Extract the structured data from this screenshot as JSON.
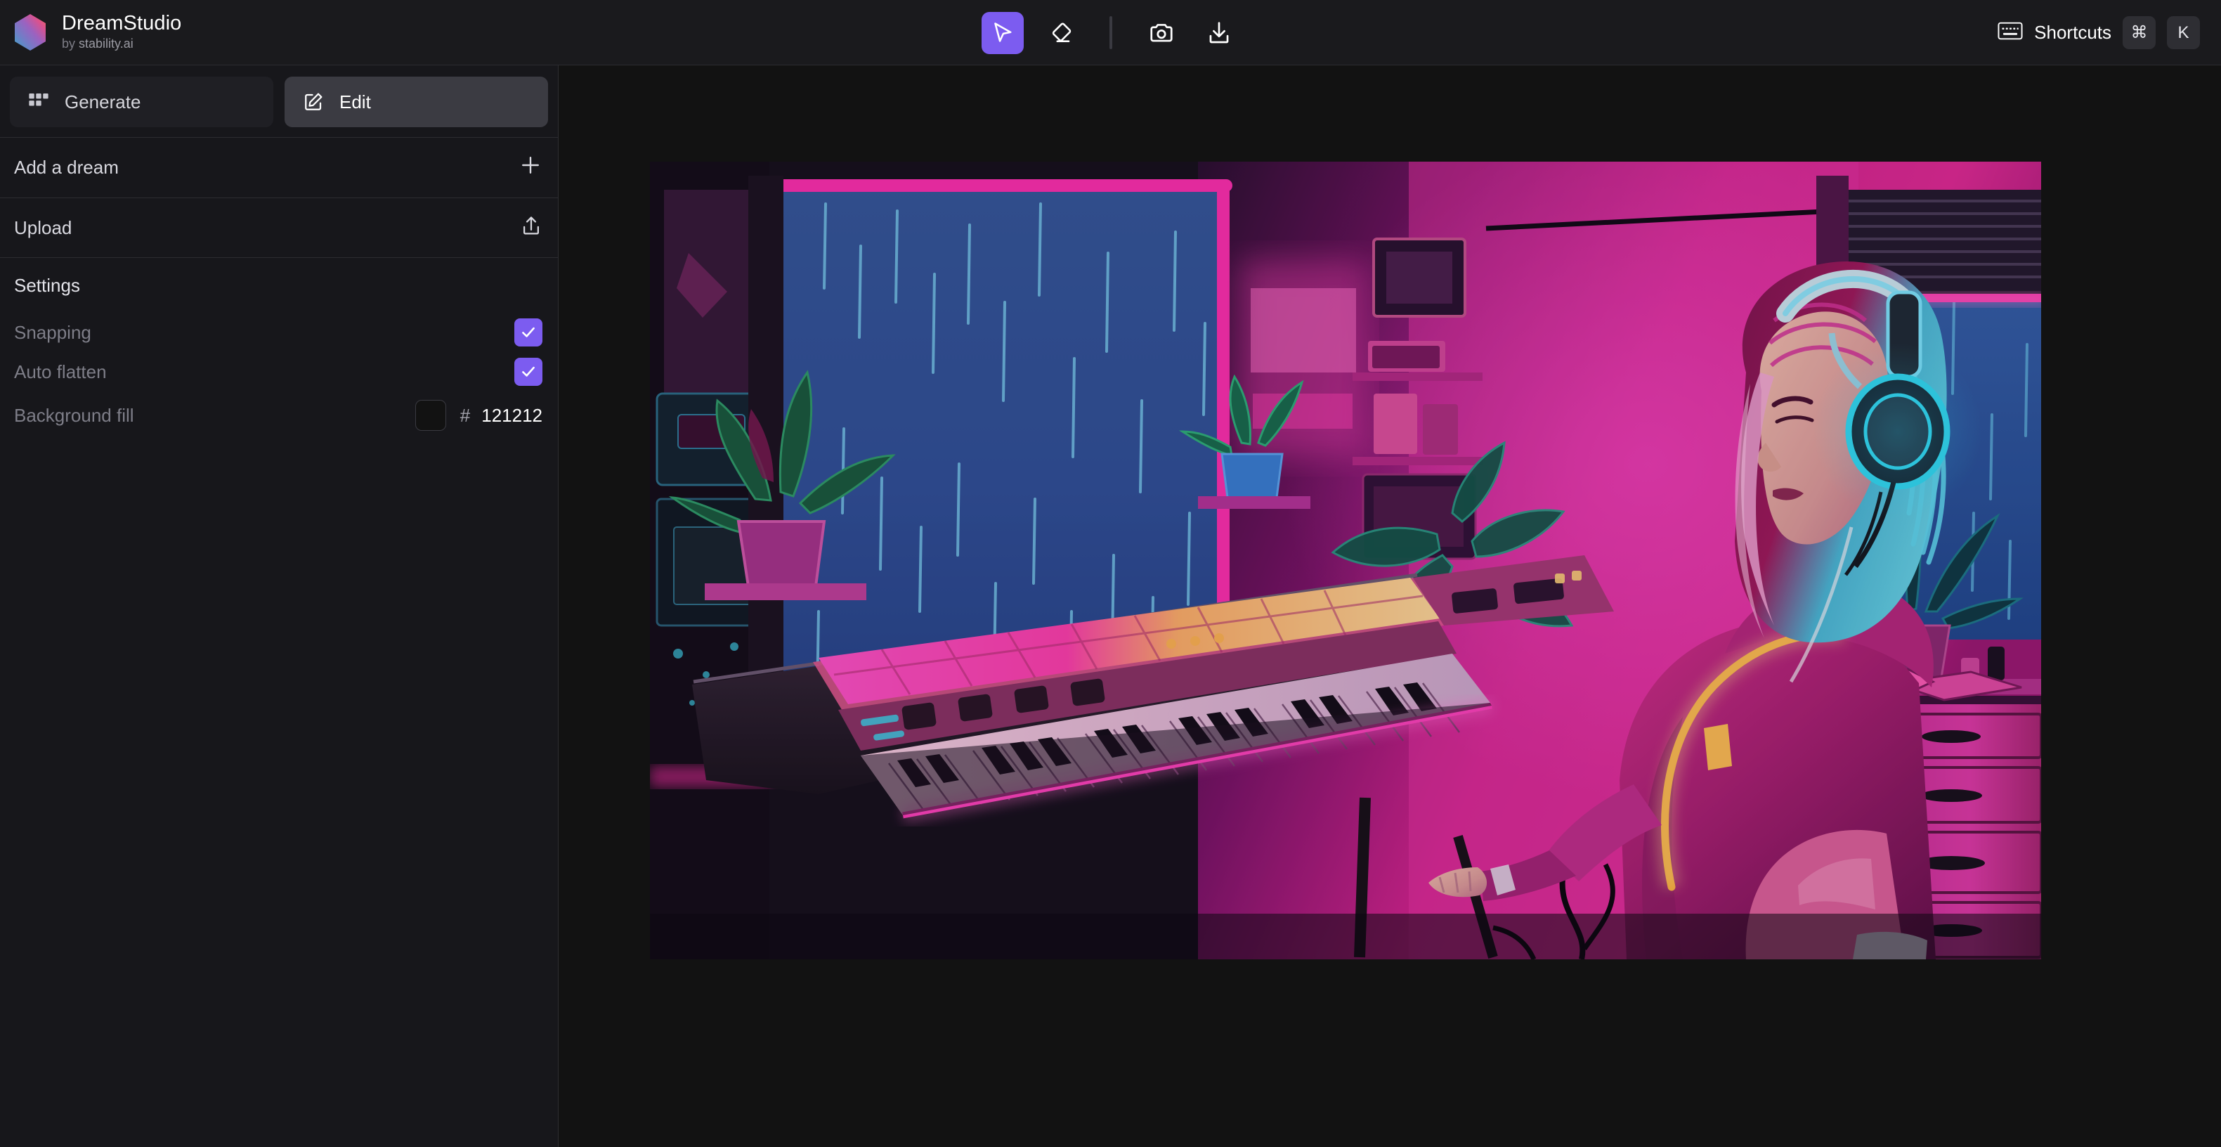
{
  "app": {
    "title": "DreamStudio",
    "subtitle_prefix": "by",
    "subtitle_brand": "stability.ai",
    "logo_icon": "hexagon-gradient-icon"
  },
  "toolbar": {
    "tools": [
      {
        "name": "select-tool",
        "icon": "cursor-arrow-icon",
        "label": "Select",
        "active": true
      },
      {
        "name": "eraser-tool",
        "icon": "eraser-icon",
        "label": "Eraser",
        "active": false
      },
      {
        "name": "capture-tool",
        "icon": "camera-icon",
        "label": "Capture",
        "active": false
      },
      {
        "name": "download-tool",
        "icon": "download-icon",
        "label": "Download",
        "active": false
      }
    ],
    "active_color": "#7c5cf0"
  },
  "shortcuts": {
    "icon": "keyboard-icon",
    "label": "Shortcuts",
    "keys": [
      "⌘",
      "K"
    ]
  },
  "sidebar": {
    "tabs": [
      {
        "label": "Generate",
        "icon": "grid-icon",
        "selected": false
      },
      {
        "label": "Edit",
        "icon": "pencil-square-icon",
        "selected": true
      }
    ],
    "rows": [
      {
        "label": "Add a dream",
        "icon": "plus-icon"
      },
      {
        "label": "Upload",
        "icon": "upload-icon"
      }
    ],
    "settings": {
      "title": "Settings",
      "options": [
        {
          "label": "Snapping",
          "checked": true
        },
        {
          "label": "Auto flatten",
          "checked": true
        }
      ],
      "background_fill": {
        "label": "Background fill",
        "hash": "#",
        "hex": "121212",
        "swatch_color": "#121212"
      }
    }
  },
  "canvas": {
    "artwork_alt": "neon cyberpunk illustration of a girl with headphones playing a synthesizer keyboard by a rainy window",
    "background": "#121212"
  }
}
